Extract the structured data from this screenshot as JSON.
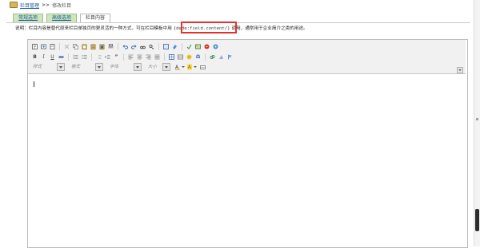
{
  "breadcrumb": {
    "parent": "栏目管理",
    "sep": ">>",
    "current": "修改栏目"
  },
  "tabs": [
    {
      "label": "常规选项"
    },
    {
      "label": "高级选项"
    },
    {
      "label": "栏目内容",
      "active": true
    }
  ],
  "note": {
    "prefix": "说明：栏目内容是替代原来栏目单独页的更灵活的一种方式，可在栏目模板中用",
    "code": "{dede:field.content/}",
    "suffix": "调用，通常用于企业简介之类的用途。"
  },
  "editor": {
    "format_placeholders": [
      "样式",
      "格式",
      "字体",
      "大小"
    ]
  },
  "colors": {
    "tab_bg": "#cfe5bd",
    "link": "#1a5a9b",
    "highlight_box": "#e0322f",
    "toolbar_bg": "#f1f1f1"
  }
}
